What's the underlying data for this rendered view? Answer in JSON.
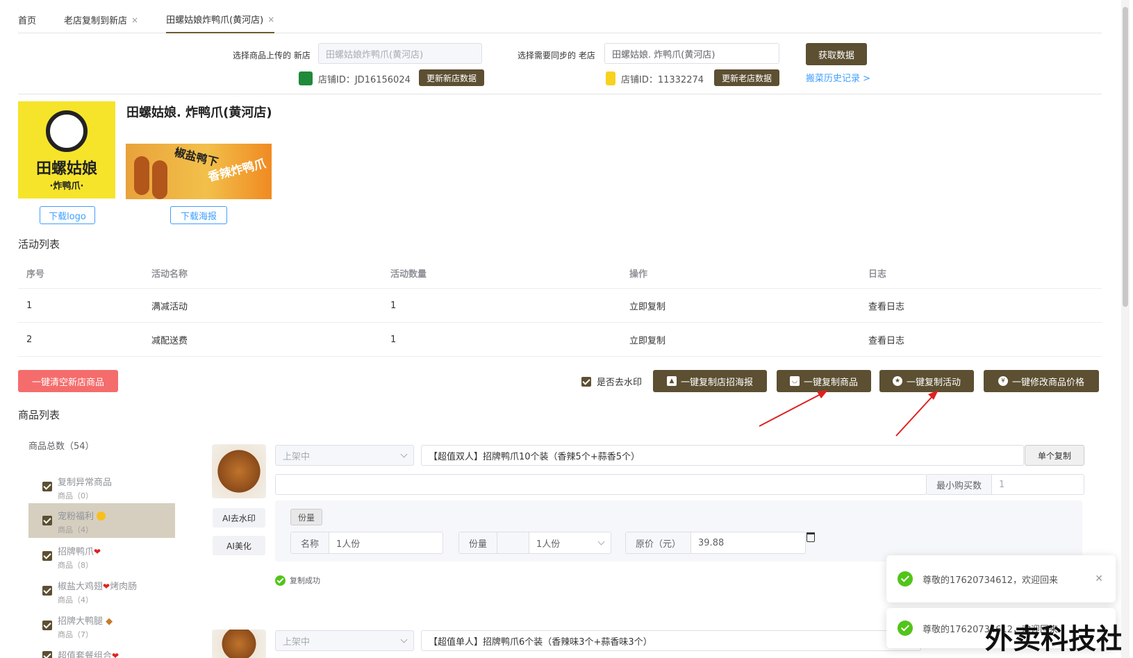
{
  "tabs": [
    {
      "label": "首页",
      "closable": false
    },
    {
      "label": "老店复制到新店",
      "closable": true
    },
    {
      "label": "田螺姑娘炸鸭爪(黄河店)",
      "closable": true,
      "active": true
    }
  ],
  "selector": {
    "new_label": "选择商品上传的 新店",
    "new_value": "田螺姑娘炸鸭爪(黄河店)",
    "old_label": "选择需要同步的 老店",
    "old_value": "田螺姑娘. 炸鸭爪(黄河店)",
    "fetch_button": "获取数据",
    "new_shop_id": "店铺ID：JD16156024",
    "new_update_button": "更新新店数据",
    "old_shop_id": "店铺ID：11332274",
    "old_update_button": "更新老店数据",
    "history_link": "搬菜历史记录 >"
  },
  "store": {
    "name": "田螺姑娘. 炸鸭爪(黄河店)",
    "logo_text_main": "田螺姑娘",
    "logo_text_sub": "·炸鸭爪·",
    "poster_text_1": "椒盐鸭下",
    "poster_text_2": "香辣炸鸭爪",
    "download_logo": "下载logo",
    "download_poster": "下载海报"
  },
  "activity": {
    "title": "活动列表",
    "headers": [
      "序号",
      "活动名称",
      "活动数量",
      "操作",
      "日志"
    ],
    "rows": [
      [
        "1",
        "满减活动",
        "1",
        "立即复制",
        "查看日志"
      ],
      [
        "2",
        "减配送费",
        "1",
        "立即复制",
        "查看日志"
      ]
    ]
  },
  "actions": {
    "clear_button": "一键清空新店商品",
    "watermark_label": "是否去水印",
    "copy_poster": "一键复制店招海报",
    "copy_goods": "一键复制商品",
    "copy_activity": "一键复制活动",
    "modify_price": "一键修改商品价格"
  },
  "goods": {
    "title": "商品列表",
    "total": "商品总数（54）",
    "categories": [
      {
        "name": "复制异常商品",
        "sub": "商品（0）"
      },
      {
        "name": "宠粉福利",
        "sub": "商品（4）",
        "selected": true
      },
      {
        "name": "招牌鸭爪",
        "sub": "商品（8）"
      },
      {
        "name": "椒盐大鸡翅",
        "name2": "烤肉肠",
        "sub": "商品（4）"
      },
      {
        "name": "招牌大鸭腿",
        "sub": "商品（7）"
      },
      {
        "name": "超值套餐组合",
        "sub": ""
      }
    ],
    "products": [
      {
        "status": "上架中",
        "title": "【超值双人】招牌鸭爪10个装（香辣5个+蒜香5个）",
        "single_copy": "单个复制",
        "min_buy_label": "最小购买数",
        "min_buy_value": "1",
        "ai_watermark": "AI去水印",
        "ai_beautify": "AI美化",
        "spec_tag": "份量",
        "name_label": "名称",
        "name_value": "1人份",
        "qty_label": "份量",
        "qty_value": "1人份",
        "price_label": "原价（元）",
        "price_value": "39.88",
        "copy_status": "复制成功"
      },
      {
        "status": "上架中",
        "title": "【超值单人】招牌鸭爪6个装（香辣味3个+蒜香味3个）"
      }
    ]
  },
  "toasts": [
    {
      "text": "尊敬的17620734612，欢迎回来"
    },
    {
      "text": "尊敬的17620734612，欢迎回来"
    }
  ],
  "watermark": "外卖科技社",
  "colors": {
    "primary": "#5c4f32",
    "danger": "#f56c6c",
    "link": "#409eff",
    "success": "#52c41a"
  }
}
